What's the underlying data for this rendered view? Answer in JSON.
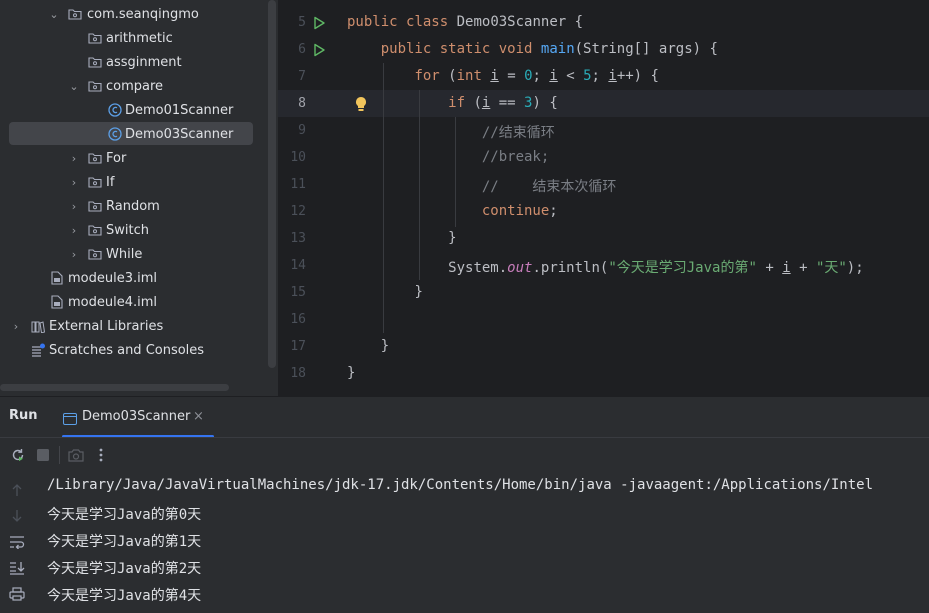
{
  "project_tree": {
    "items": [
      {
        "label": "com.seanqingmo",
        "type": "package"
      },
      {
        "label": "arithmetic",
        "type": "package"
      },
      {
        "label": "assginment",
        "type": "package"
      },
      {
        "label": "compare",
        "type": "package"
      },
      {
        "label": "Demo01Scanner",
        "type": "class"
      },
      {
        "label": "Demo03Scanner",
        "type": "class",
        "selected": true
      },
      {
        "label": "For",
        "type": "package"
      },
      {
        "label": "If",
        "type": "package"
      },
      {
        "label": "Random",
        "type": "package"
      },
      {
        "label": "Switch",
        "type": "package"
      },
      {
        "label": "While",
        "type": "package"
      },
      {
        "label": "modeule3.iml",
        "type": "file"
      },
      {
        "label": "modeule4.iml",
        "type": "file"
      },
      {
        "label": "External Libraries",
        "type": "library"
      },
      {
        "label": "Scratches and Consoles",
        "type": "scratches"
      }
    ]
  },
  "editor": {
    "lines": [
      {
        "n": "5"
      },
      {
        "n": "6"
      },
      {
        "n": "7"
      },
      {
        "n": "8"
      },
      {
        "n": "9"
      },
      {
        "n": "10"
      },
      {
        "n": "11"
      },
      {
        "n": "12"
      },
      {
        "n": "13"
      },
      {
        "n": "14"
      },
      {
        "n": "15"
      },
      {
        "n": "16"
      },
      {
        "n": "17"
      },
      {
        "n": "18"
      }
    ],
    "tokens": {
      "public": "public",
      "class": "class",
      "class_name": "Demo03Scanner",
      "brace_open": " {",
      "static": "static",
      "void": "void",
      "main": "main",
      "main_args": "(String[] args) {",
      "for": "for",
      "for_open": " (",
      "int": "int",
      "i": "i",
      "eq": " = ",
      "zero": "0",
      "semi": "; ",
      "lt": " < ",
      "five": "5",
      "inc": "++) {",
      "if": "if",
      "if_open": " (",
      "eqeq": " == ",
      "three": "3",
      "if_close": ") {",
      "comment1": "//结束循环",
      "comment2": "//break;",
      "comment3": "//    结束本次循环",
      "continue": "continue",
      "semicolon": ";",
      "close_brace": "}",
      "system": "System.",
      "out": "out",
      "println": ".println(",
      "str1": "\"今天是学习Java的第\"",
      "plus": " + ",
      "str2": "\"天\"",
      "end": ");"
    },
    "current_line": "8"
  },
  "run_panel": {
    "title": "Run",
    "tab_label": "Demo03Scanner",
    "close": "×",
    "console": [
      "/Library/Java/JavaVirtualMachines/jdk-17.jdk/Contents/Home/bin/java -javaagent:/Applications/Intel",
      "今天是学习Java的第0天",
      "今天是学习Java的第1天",
      "今天是学习Java的第2天",
      "今天是学习Java的第4天"
    ]
  },
  "colors": {
    "keyword": "#cf8e6d",
    "function": "#56a8f5",
    "number": "#2aacb8",
    "string": "#6aab73",
    "comment": "#7a7e85",
    "field": "#c77dbb",
    "accent": "#3574f0",
    "run_green": "#5fb865"
  }
}
